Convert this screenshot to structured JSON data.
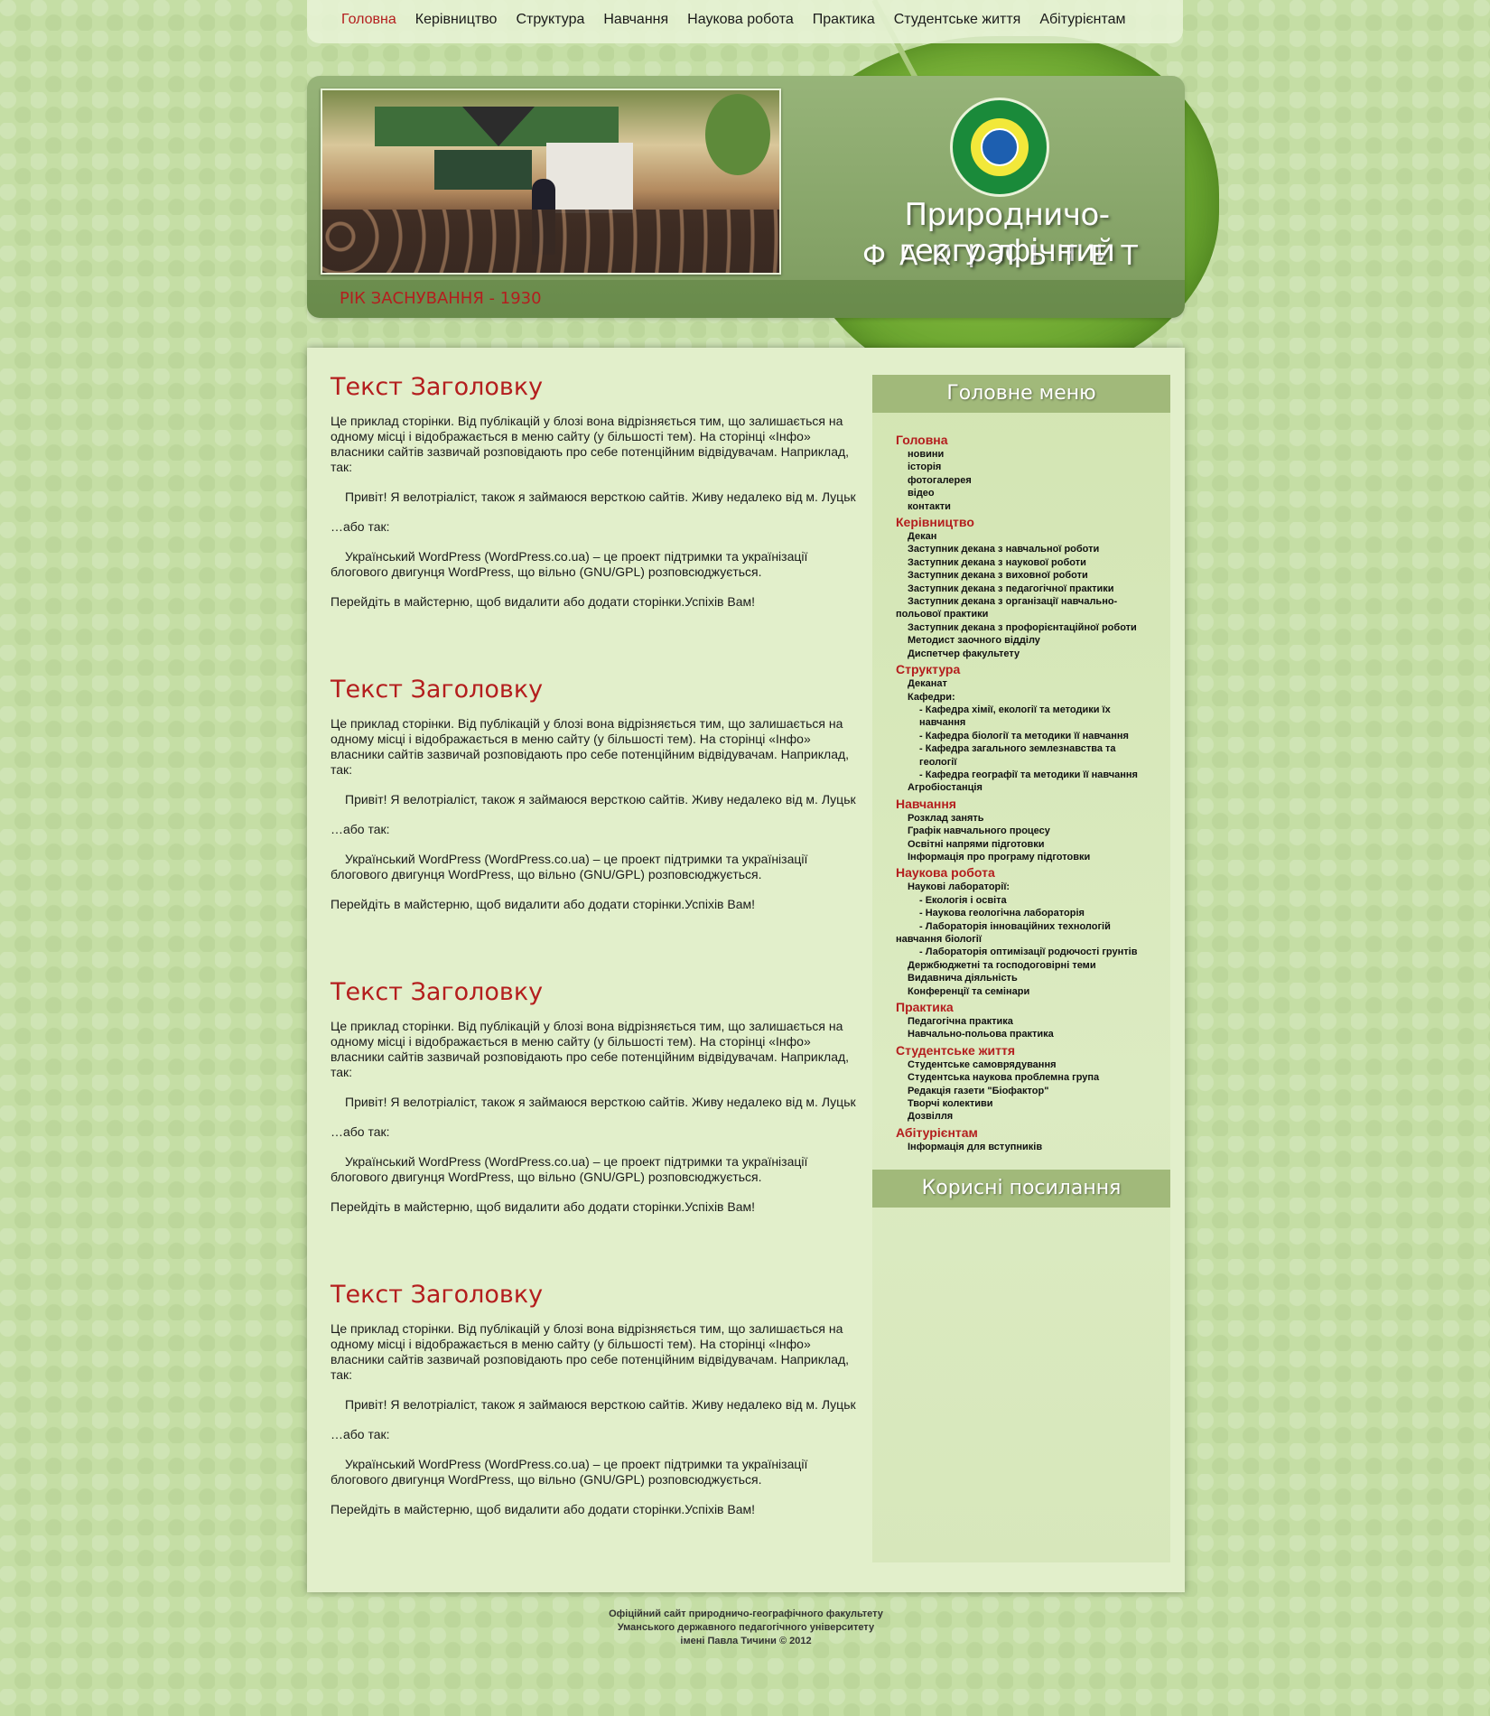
{
  "nav": {
    "items": [
      {
        "label": "Головна",
        "active": true
      },
      {
        "label": "Керівництво"
      },
      {
        "label": "Структура"
      },
      {
        "label": "Навчання"
      },
      {
        "label": "Наукова робота"
      },
      {
        "label": "Практика"
      },
      {
        "label": "Студентське життя"
      },
      {
        "label": "Абітурієнтам"
      }
    ]
  },
  "header": {
    "title": "Природничо-географічний",
    "subtitle": "ФАКУЛЬТЕТ",
    "founded": "РІК ЗАСНУВАННЯ - 1930"
  },
  "posts": [
    {
      "title": "Текст Заголовку",
      "p1": "Це приклад сторінки. Від публікацій у блозі вона відрізняється тим, що залишається на одному місці і відображається в меню сайту (у більшості тем). На сторінці «Інфо» власники сайтів зазвичай розповідають про себе потенційним відвідувачам. Наприклад, так:",
      "p2": "Привіт! Я велотріаліст, також я займаюся версткою сайтів. Живу недалеко від м. Луцьк",
      "p3": "…або так:",
      "p4": "Український WordPress (WordPress.co.ua) – це проект підтримки та українізації блогового двигунця WordPress, що вільно (GNU/GPL) розповсюджується.",
      "p5": "Перейдіть в майстерню, щоб видалити або додати сторінки.Успіхів Вам!"
    },
    {
      "title": "Текст Заголовку",
      "p1": "Це приклад сторінки. Від публікацій у блозі вона відрізняється тим, що залишається на одному місці і відображається в меню сайту (у більшості тем). На сторінці «Інфо» власники сайтів зазвичай розповідають про себе потенційним відвідувачам. Наприклад, так:",
      "p2": "Привіт! Я велотріаліст, також я займаюся версткою сайтів. Живу недалеко від м. Луцьк",
      "p3": "…або так:",
      "p4": "Український WordPress (WordPress.co.ua) – це проект підтримки та українізації блогового двигунця WordPress, що вільно (GNU/GPL) розповсюджується.",
      "p5": "Перейдіть в майстерню, щоб видалити або додати сторінки.Успіхів Вам!"
    },
    {
      "title": "Текст Заголовку",
      "p1": "Це приклад сторінки. Від публікацій у блозі вона відрізняється тим, що залишається на одному місці і відображається в меню сайту (у більшості тем). На сторінці «Інфо» власники сайтів зазвичай розповідають про себе потенційним відвідувачам. Наприклад, так:",
      "p2": "Привіт! Я велотріаліст, також я займаюся версткою сайтів. Живу недалеко від м. Луцьк",
      "p3": "…або так:",
      "p4": "Український WordPress (WordPress.co.ua) – це проект підтримки та українізації блогового двигунця WordPress, що вільно (GNU/GPL) розповсюджується.",
      "p5": "Перейдіть в майстерню, щоб видалити або додати сторінки.Успіхів Вам!"
    },
    {
      "title": "Текст Заголовку",
      "p1": "Це приклад сторінки. Від публікацій у блозі вона відрізняється тим, що залишається на одному місці і відображається в меню сайту (у більшості тем). На сторінці «Інфо» власники сайтів зазвичай розповідають про себе потенційним відвідувачам. Наприклад, так:",
      "p2": "Привіт! Я велотріаліст, також я займаюся версткою сайтів. Живу недалеко від м. Луцьк",
      "p3": "…або так:",
      "p4": "Український WordPress (WordPress.co.ua) – це проект підтримки та українізації блогового двигунця WordPress, що вільно (GNU/GPL) розповсюджується.",
      "p5": "Перейдіть в майстерню, щоб видалити або додати сторінки.Успіхів Вам!"
    }
  ],
  "sidebar": {
    "menu_title": "Головне меню",
    "links_title": "Корисні посилання",
    "menu": [
      {
        "label": "Головна",
        "kind": "sec"
      },
      {
        "label": "новини",
        "kind": "it"
      },
      {
        "label": "історія",
        "kind": "it"
      },
      {
        "label": "фотогалерея",
        "kind": "it"
      },
      {
        "label": "відео",
        "kind": "it"
      },
      {
        "label": "контакти",
        "kind": "it"
      },
      {
        "label": "Керівництво",
        "kind": "sec"
      },
      {
        "label": "Декан",
        "kind": "it"
      },
      {
        "label": "Заступник декана з навчальної роботи",
        "kind": "it"
      },
      {
        "label": "Заступник декана з наукової роботи",
        "kind": "it"
      },
      {
        "label": "Заступник декана з виховної роботи",
        "kind": "it"
      },
      {
        "label": "Заступник декана з педагогічної практики",
        "kind": "it"
      },
      {
        "label": "Заступник декана з організації навчально-польової практики",
        "kind": "it wrap"
      },
      {
        "label": "Заступник декана з профорієнтаційної роботи",
        "kind": "it"
      },
      {
        "label": "Методист заочного відділу",
        "kind": "it"
      },
      {
        "label": "Диспетчер факультету",
        "kind": "it"
      },
      {
        "label": "Структура",
        "kind": "sec"
      },
      {
        "label": "Деканат",
        "kind": "it"
      },
      {
        "label": "Кафедри:",
        "kind": "it"
      },
      {
        "label": "- Кафедра хімії, екології та методики їх навчання",
        "kind": "it sub"
      },
      {
        "label": "- Кафедра біології та методики її навчання",
        "kind": "it sub"
      },
      {
        "label": "- Кафедра загального землезнавства та геології",
        "kind": "it sub"
      },
      {
        "label": "- Кафедра географії та методики її навчання",
        "kind": "it sub"
      },
      {
        "label": "Агробіостанція",
        "kind": "it"
      },
      {
        "label": "Навчання",
        "kind": "sec"
      },
      {
        "label": "Розклад занять",
        "kind": "it"
      },
      {
        "label": "Графік навчального процесу",
        "kind": "it"
      },
      {
        "label": "Освітні напрями підготовки",
        "kind": "it"
      },
      {
        "label": "Інформація про програму підготовки",
        "kind": "it"
      },
      {
        "label": "Наукова робота",
        "kind": "sec"
      },
      {
        "label": "Наукові лабораторії:",
        "kind": "it"
      },
      {
        "label": "- Екологія і освіта",
        "kind": "it sub"
      },
      {
        "label": "- Наукова геологічна лабораторія",
        "kind": "it sub"
      },
      {
        "label": "- Лабораторія інноваційних технологій навчання біології",
        "kind": "it sub wrap"
      },
      {
        "label": "- Лабораторія оптимізації родючості грунтів",
        "kind": "it sub"
      },
      {
        "label": "Держбюджетні та господоговірні теми",
        "kind": "it"
      },
      {
        "label": "Видавнича діяльність",
        "kind": "it"
      },
      {
        "label": "Конференції та семінари",
        "kind": "it"
      },
      {
        "label": "Практика",
        "kind": "sec"
      },
      {
        "label": "Педагогічна практика",
        "kind": "it"
      },
      {
        "label": "Навчально-польова практика",
        "kind": "it"
      },
      {
        "label": "Студентське життя",
        "kind": "sec"
      },
      {
        "label": "Студентське самоврядування",
        "kind": "it"
      },
      {
        "label": "Студентська наукова проблемна група",
        "kind": "it"
      },
      {
        "label": "Редакція газети \"Біофактор\"",
        "kind": "it"
      },
      {
        "label": "Творчі колективи",
        "kind": "it"
      },
      {
        "label": "Дозвілля",
        "kind": "it"
      },
      {
        "label": "Абітурієнтам",
        "kind": "sec"
      },
      {
        "label": "Інформація для вступників",
        "kind": "it"
      }
    ]
  },
  "footer": {
    "line1": "Офіційний сайт природничо-географічного факультету",
    "line2": "Уманського державного педагогічного університету",
    "line3": "імені Павла Тичини © 2012"
  }
}
